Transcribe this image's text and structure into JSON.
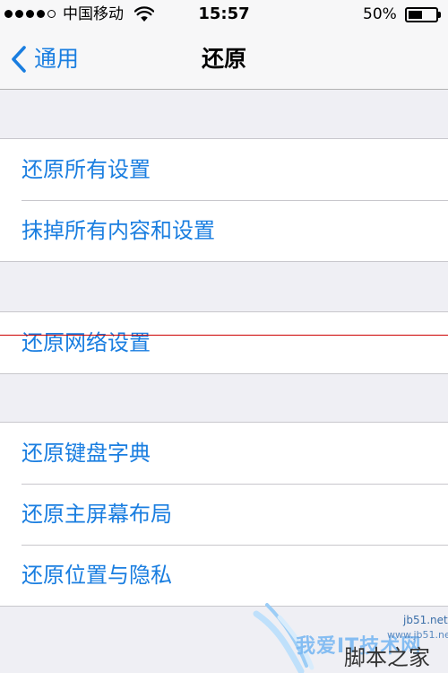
{
  "status_bar": {
    "signal_bars": "●●●●○",
    "carrier": "中国移动",
    "wifi_icon": "wifi-icon",
    "time": "15:57",
    "battery_percent": "50%",
    "battery_level": 0.5
  },
  "nav": {
    "back_label": "通用",
    "back_icon": "chevron-left-icon",
    "title": "还原"
  },
  "groups": [
    {
      "items": [
        {
          "label": "还原所有设置"
        },
        {
          "label": "抹掉所有内容和设置"
        }
      ]
    },
    {
      "items": [
        {
          "label": "还原网络设置"
        }
      ]
    },
    {
      "items": [
        {
          "label": "还原键盘字典"
        },
        {
          "label": "还原主屏幕布局"
        },
        {
          "label": "还原位置与隐私"
        }
      ]
    }
  ],
  "watermark": {
    "text": "我爱IT技术网",
    "url": "jb51.net",
    "brand": "脚本之家",
    "url2": "www.jb51.net"
  },
  "colors": {
    "accent": "#1a7ee0",
    "background": "#efeff4",
    "annotation_line": "#cc0000"
  }
}
